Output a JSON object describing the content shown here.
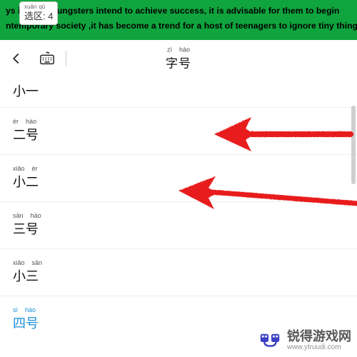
{
  "banner": {
    "line1_pre": "ys i",
    "line1_post": "oungsters intend to achieve success, it is advisable for them to begin",
    "line2": "ntemporary society ,it has become a trend for a host of teenagers to ignore tiny things in"
  },
  "selection_badge": {
    "pinyin": [
      "xuǎn",
      "qū"
    ],
    "main": "选区: 4"
  },
  "header": {
    "title_pinyin": [
      "zì",
      "hào"
    ],
    "title": "字号"
  },
  "font_sizes": [
    {
      "pinyin": [],
      "label": "小一",
      "selected": false
    },
    {
      "pinyin": [
        "èr",
        "hào"
      ],
      "label": "二号",
      "selected": false
    },
    {
      "pinyin": [
        "xiǎo",
        "èr"
      ],
      "label": "小二",
      "selected": false
    },
    {
      "pinyin": [
        "sān",
        "hào"
      ],
      "label": "三号",
      "selected": false
    },
    {
      "pinyin": [
        "xiǎo",
        "sān"
      ],
      "label": "小三",
      "selected": false
    },
    {
      "pinyin": [
        "sì",
        "hào"
      ],
      "label": "四号",
      "selected": true
    }
  ],
  "watermark": {
    "brand": "锐得游戏网",
    "url": "www.ytruudi.com"
  }
}
